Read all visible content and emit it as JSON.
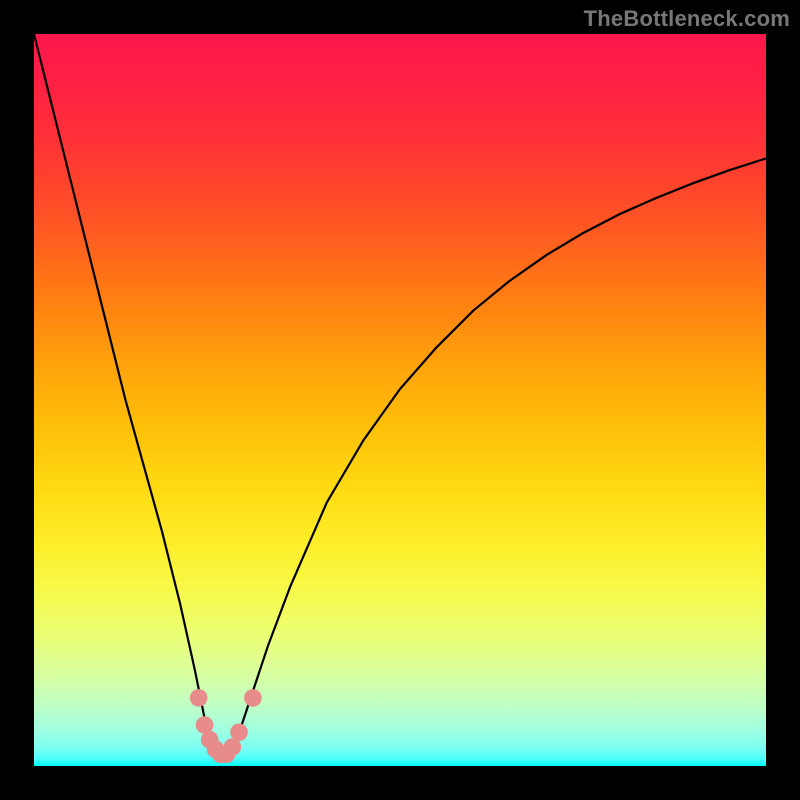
{
  "watermark": "TheBottleneck.com",
  "chart_data": {
    "type": "line",
    "title": "",
    "xlabel": "",
    "ylabel": "",
    "xlim": [
      0,
      100
    ],
    "ylim": [
      0,
      100
    ],
    "grid": false,
    "legend": false,
    "background_gradient": [
      {
        "stop": 0.0,
        "color": "#ff174c"
      },
      {
        "stop": 0.35,
        "color": "#ff7a14"
      },
      {
        "stop": 0.62,
        "color": "#ffda13"
      },
      {
        "stop": 0.83,
        "color": "#e9ff7c"
      },
      {
        "stop": 1.0,
        "color": "#00fff9"
      }
    ],
    "series": [
      {
        "name": "bottleneck-curve",
        "color": "#000000",
        "x": [
          0,
          2.5,
          5,
          7.5,
          10,
          12.5,
          15,
          17.5,
          20,
          21,
          22,
          23,
          23.5,
          24,
          24.5,
          25,
          25.5,
          26,
          27,
          28,
          29,
          30,
          32,
          35,
          40,
          45,
          50,
          55,
          60,
          65,
          70,
          75,
          80,
          85,
          90,
          95,
          100
        ],
        "y": [
          100,
          90,
          80,
          70,
          60,
          50,
          41,
          32,
          22,
          17.5,
          13,
          8,
          5.5,
          3.5,
          2.2,
          1.5,
          1.2,
          1.3,
          2.2,
          4.5,
          7.5,
          10.5,
          16.5,
          24.5,
          36,
          44.5,
          51.5,
          57.2,
          62.2,
          66.3,
          69.8,
          72.8,
          75.4,
          77.6,
          79.6,
          81.4,
          83
        ]
      }
    ],
    "markers": [
      {
        "name": "marker-1",
        "x": 22.5,
        "y": 9.3,
        "color": "#e78b8b",
        "r": 1.2
      },
      {
        "name": "marker-2",
        "x": 23.3,
        "y": 5.6,
        "color": "#e78b8b",
        "r": 1.2
      },
      {
        "name": "marker-3",
        "x": 24.0,
        "y": 3.6,
        "color": "#e78b8b",
        "r": 1.2
      },
      {
        "name": "marker-4",
        "x": 24.8,
        "y": 2.3,
        "color": "#e78b8b",
        "r": 1.2
      },
      {
        "name": "marker-5",
        "x": 25.5,
        "y": 1.6,
        "color": "#e78b8b",
        "r": 1.2
      },
      {
        "name": "marker-6",
        "x": 26.3,
        "y": 1.6,
        "color": "#e78b8b",
        "r": 1.2
      },
      {
        "name": "marker-7",
        "x": 27.1,
        "y": 2.6,
        "color": "#e78b8b",
        "r": 1.2
      },
      {
        "name": "marker-8",
        "x": 28.0,
        "y": 4.6,
        "color": "#e78b8b",
        "r": 1.2
      },
      {
        "name": "marker-9",
        "x": 29.9,
        "y": 9.3,
        "color": "#e78b8b",
        "r": 1.2
      }
    ]
  }
}
